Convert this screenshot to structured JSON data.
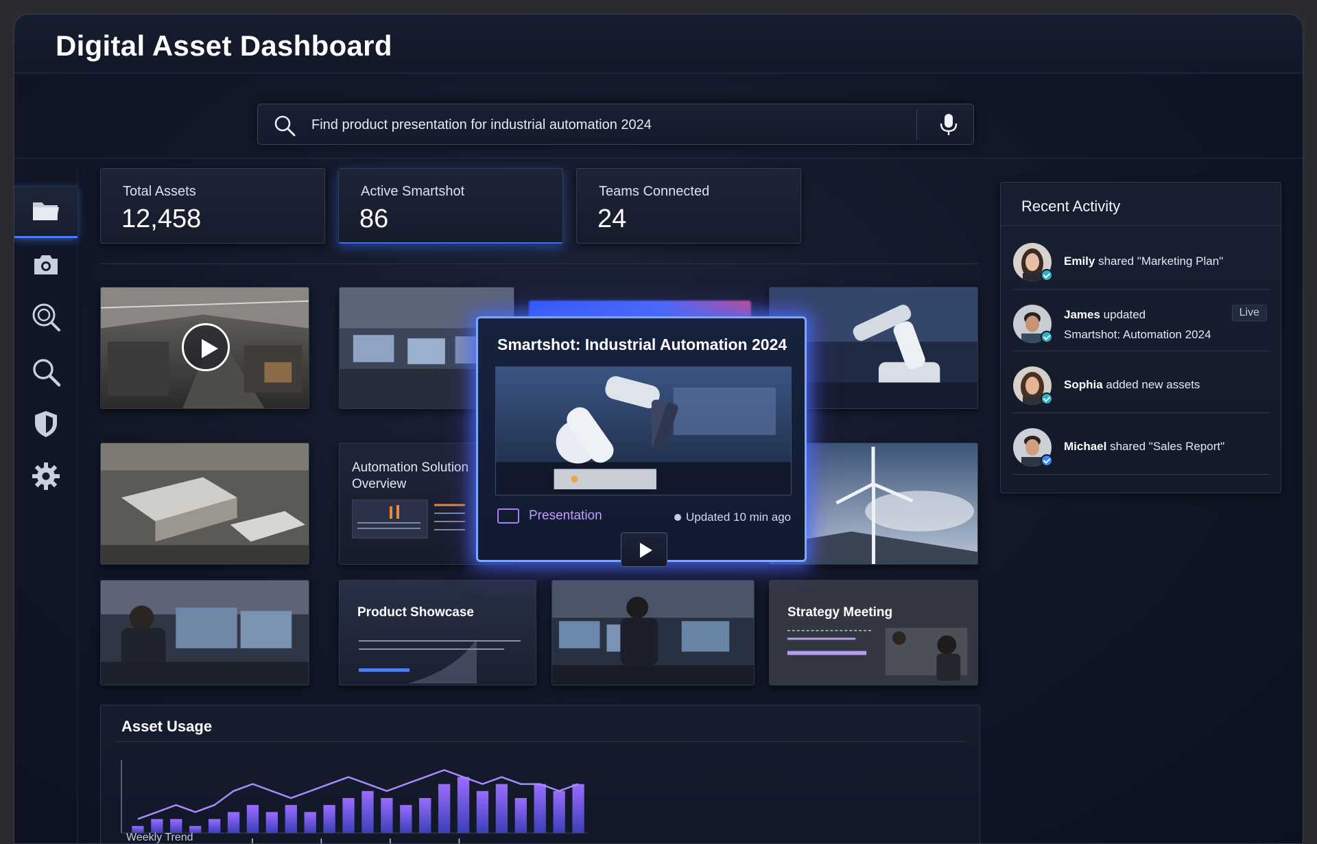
{
  "app": {
    "title": "Digital Asset Dashboard"
  },
  "search": {
    "query": "Find product presentation for industrial automation 2024"
  },
  "sidebar": {
    "items": [
      {
        "icon": "folder-icon",
        "active": true
      },
      {
        "icon": "camera-icon"
      },
      {
        "icon": "scan-search-icon"
      },
      {
        "icon": "search-icon"
      },
      {
        "icon": "shield-icon"
      },
      {
        "icon": "gear-icon"
      }
    ]
  },
  "stats": [
    {
      "label": "Total Assets",
      "value": "12,458"
    },
    {
      "label": "Active Smartshot",
      "value": "86"
    },
    {
      "label": "Teams Connected",
      "value": "24"
    }
  ],
  "tiles": {
    "automation": {
      "title": "Automation Solution Overview"
    },
    "product": {
      "title": "Product Showcase"
    },
    "strategy": {
      "title": "Strategy Meeting"
    }
  },
  "featured": {
    "title": "Smartshot: Industrial Automation 2024",
    "type": "Presentation",
    "updated": "Updated 10 min ago"
  },
  "activity": {
    "heading": "Recent Activity",
    "items": [
      {
        "name": "Emily",
        "action": " shared \"Marketing Plan\""
      },
      {
        "name": "James",
        "action": " updated",
        "line2": "Smartshot: Automation 2024",
        "badge": "Live"
      },
      {
        "name": "Sophia",
        "action": " added new assets"
      },
      {
        "name": "Michael",
        "action": " shared \"Sales Report\""
      }
    ]
  },
  "usage": {
    "title": "Asset Usage",
    "subtitle": "Weekly Trend"
  },
  "chart_data": {
    "type": "bar",
    "title": "Asset Usage",
    "xlabel": "Weekly Trend",
    "values": [
      1,
      2,
      2,
      1,
      2,
      3,
      4,
      3,
      4,
      3,
      4,
      5,
      6,
      5,
      4,
      5,
      7,
      8,
      6,
      7,
      5,
      7,
      6,
      7
    ],
    "line_values": [
      2,
      3,
      4,
      3,
      4,
      6,
      7,
      6,
      5,
      6,
      7,
      8,
      7,
      6,
      7,
      8,
      9,
      8,
      7,
      8,
      7,
      7,
      6,
      7
    ],
    "colors": {
      "bar": "#7b5cf0",
      "line": "#a77bff"
    }
  }
}
